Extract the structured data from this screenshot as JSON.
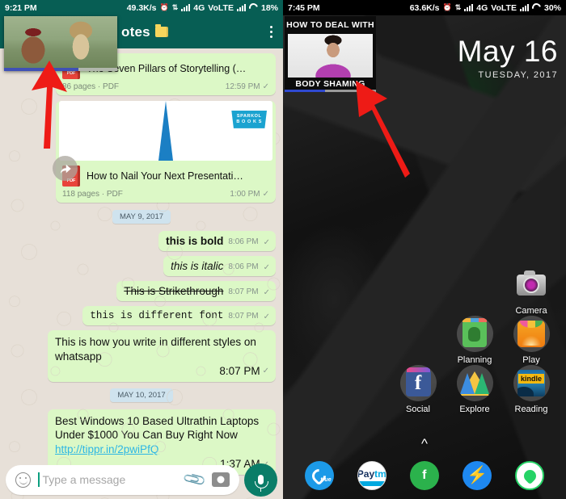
{
  "left_phone": {
    "status_bar": {
      "time": "9:21 PM",
      "net_speed": "49.3K/s",
      "alarm_icon": "alarm-clock-icon",
      "data_icon": "data-transfer-icon",
      "signal_icon": "signal-bars-icon",
      "network": "4G",
      "volte": "VoLTE",
      "signal2_icon": "signal-bars-icon",
      "battery_icon": "battery-circle-icon",
      "battery": "18%"
    },
    "header": {
      "title": "otes",
      "folder_icon": "folder-icon",
      "overflow_icon": "more-vertical-icon"
    },
    "pip_video": {
      "name": "floating-video-player",
      "progress": "66%"
    },
    "forward_button": {
      "icon": "forward-arrow-icon"
    },
    "messages": [
      {
        "type": "document",
        "name": "The Seven Pillars of Storytelling (…",
        "meta": "86 pages · PDF",
        "time": "12:59 PM",
        "tick": "✓",
        "file_icon": "pdf-file-icon",
        "has_thumb": false
      },
      {
        "type": "document",
        "name": "How to Nail Your Next Presentati…",
        "meta": "118 pages · PDF",
        "time": "1:00 PM",
        "tick": "✓",
        "file_icon": "pdf-file-icon",
        "has_thumb": true,
        "thumb_logo_line1": "SPARKOL",
        "thumb_logo_line2": "B O O K S"
      },
      {
        "type": "daystamp",
        "label": "MAY 9, 2017"
      },
      {
        "type": "text",
        "style": "bold",
        "text": "this is bold",
        "time": "8:06 PM",
        "tick": "✓"
      },
      {
        "type": "text",
        "style": "italic",
        "text": "this is italic",
        "time": "8:06 PM",
        "tick": "✓"
      },
      {
        "type": "text",
        "style": "strike",
        "text": "This is Strikethrough",
        "time": "8:07 PM",
        "tick": "✓"
      },
      {
        "type": "text",
        "style": "mono",
        "text": "this is different font",
        "time": "8:07 PM",
        "tick": "✓"
      },
      {
        "type": "block",
        "text": "This is how you write in different styles on whatsapp",
        "time": "8:07 PM",
        "tick": "✓"
      },
      {
        "type": "daystamp",
        "label": "MAY 10, 2017"
      },
      {
        "type": "block_link",
        "text": "Best Windows 10 Based Ultrathin Laptops Under $1000 You Can Buy Right Now ",
        "link": "http://tippr.in/2pwiPfQ",
        "time": "1:37 AM",
        "tick": "✓"
      }
    ],
    "input_bar": {
      "emoji_icon": "emoji-smiley-icon",
      "placeholder": "Type a message",
      "value": "",
      "attach_icon": "paperclip-icon",
      "camera_icon": "camera-icon",
      "mic_icon": "microphone-icon"
    }
  },
  "right_phone": {
    "status_bar": {
      "time": "7:45 PM",
      "net_speed": "63.6K/s",
      "alarm_icon": "alarm-clock-icon",
      "data_icon": "data-transfer-icon",
      "signal_icon": "signal-bars-icon",
      "network": "4G",
      "volte": "VoLTE",
      "signal2_icon": "signal-bars-icon",
      "battery_icon": "battery-circle-icon",
      "battery": "30%"
    },
    "pip_video": {
      "name": "floating-video-player",
      "title_top": "HOW TO DEAL WITH",
      "title_bottom": "BODY SHAMING",
      "progress": "44%"
    },
    "clock_widget": {
      "date": "May 16",
      "day": "TUESDAY, 2017"
    },
    "calendar_icon": {
      "name": "calendar-app-icon"
    },
    "apps": [
      {
        "label": "Camera",
        "icon": "camera-app-icon"
      },
      {
        "label": "Planning",
        "icon": "evernote-app-icon"
      },
      {
        "label": "Play",
        "icon": "google-play-app-icon"
      },
      {
        "label": "Social",
        "icon": "facebook-app-icon"
      },
      {
        "label": "Explore",
        "icon": "google-drive-app-icon"
      },
      {
        "label": "Reading",
        "icon": "kindle-app-icon"
      }
    ],
    "app_drawer_chevron": "chevron-up-icon",
    "dock": [
      {
        "name": "truecaller-dock-icon",
        "label": "true"
      },
      {
        "name": "paytm-dock-icon",
        "label_pay": "Pay",
        "label_tm": "tm"
      },
      {
        "name": "feedly-dock-icon",
        "label": "f"
      },
      {
        "name": "messenger-dock-icon",
        "label": "⚡"
      },
      {
        "name": "whatsapp-dock-icon",
        "label": ""
      }
    ]
  },
  "annotations": {
    "left_arrow": {
      "name": "red-arrow-pointing-to-floating-video"
    },
    "right_arrow": {
      "name": "red-arrow-pointing-to-floating-video"
    },
    "color": "#ee1b16"
  },
  "colors": {
    "whatsapp_header": "#075e54",
    "outgoing_bubble": "#dcf8c6",
    "chat_background": "#e7e0d8",
    "link": "#2eb7e4",
    "accent_red": "#ee1b16"
  }
}
